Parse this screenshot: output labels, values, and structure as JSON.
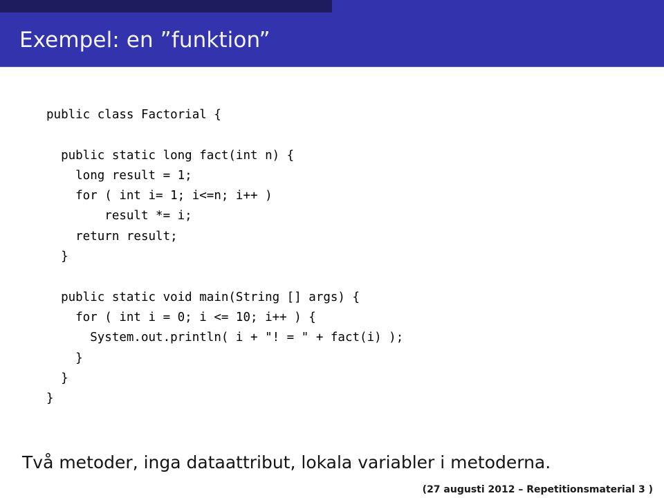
{
  "slide": {
    "title": "Exempel: en ”funktion”",
    "caption": "Två metoder, inga dataattribut, lokala variabler i metoderna.",
    "footer": "(27 augusti 2012  –  Repetitionsmaterial 3 )"
  },
  "theme": {
    "title_bar_color": "#3333ad",
    "title_bar_dark_color": "#1c1c5e",
    "title_text_color": "#f4f4f8",
    "body_background": "#ffffff",
    "code_text_color": "#000000",
    "caption_text_color": "#141414",
    "footer_text_color": "#1a1a1a"
  },
  "code": {
    "language": "java",
    "lines": [
      "public class Factorial {",
      "",
      "  public static long fact(int n) {",
      "    long result = 1;",
      "    for ( int i= 1; i<=n; i++ )",
      "        result *= i;",
      "    return result;",
      "  }",
      "",
      "  public static void main(String [] args) {",
      "    for ( int i = 0; i <= 10; i++ ) {",
      "      System.out.println( i + \"! = \" + fact(i) );",
      "    }",
      "  }",
      "}"
    ]
  }
}
